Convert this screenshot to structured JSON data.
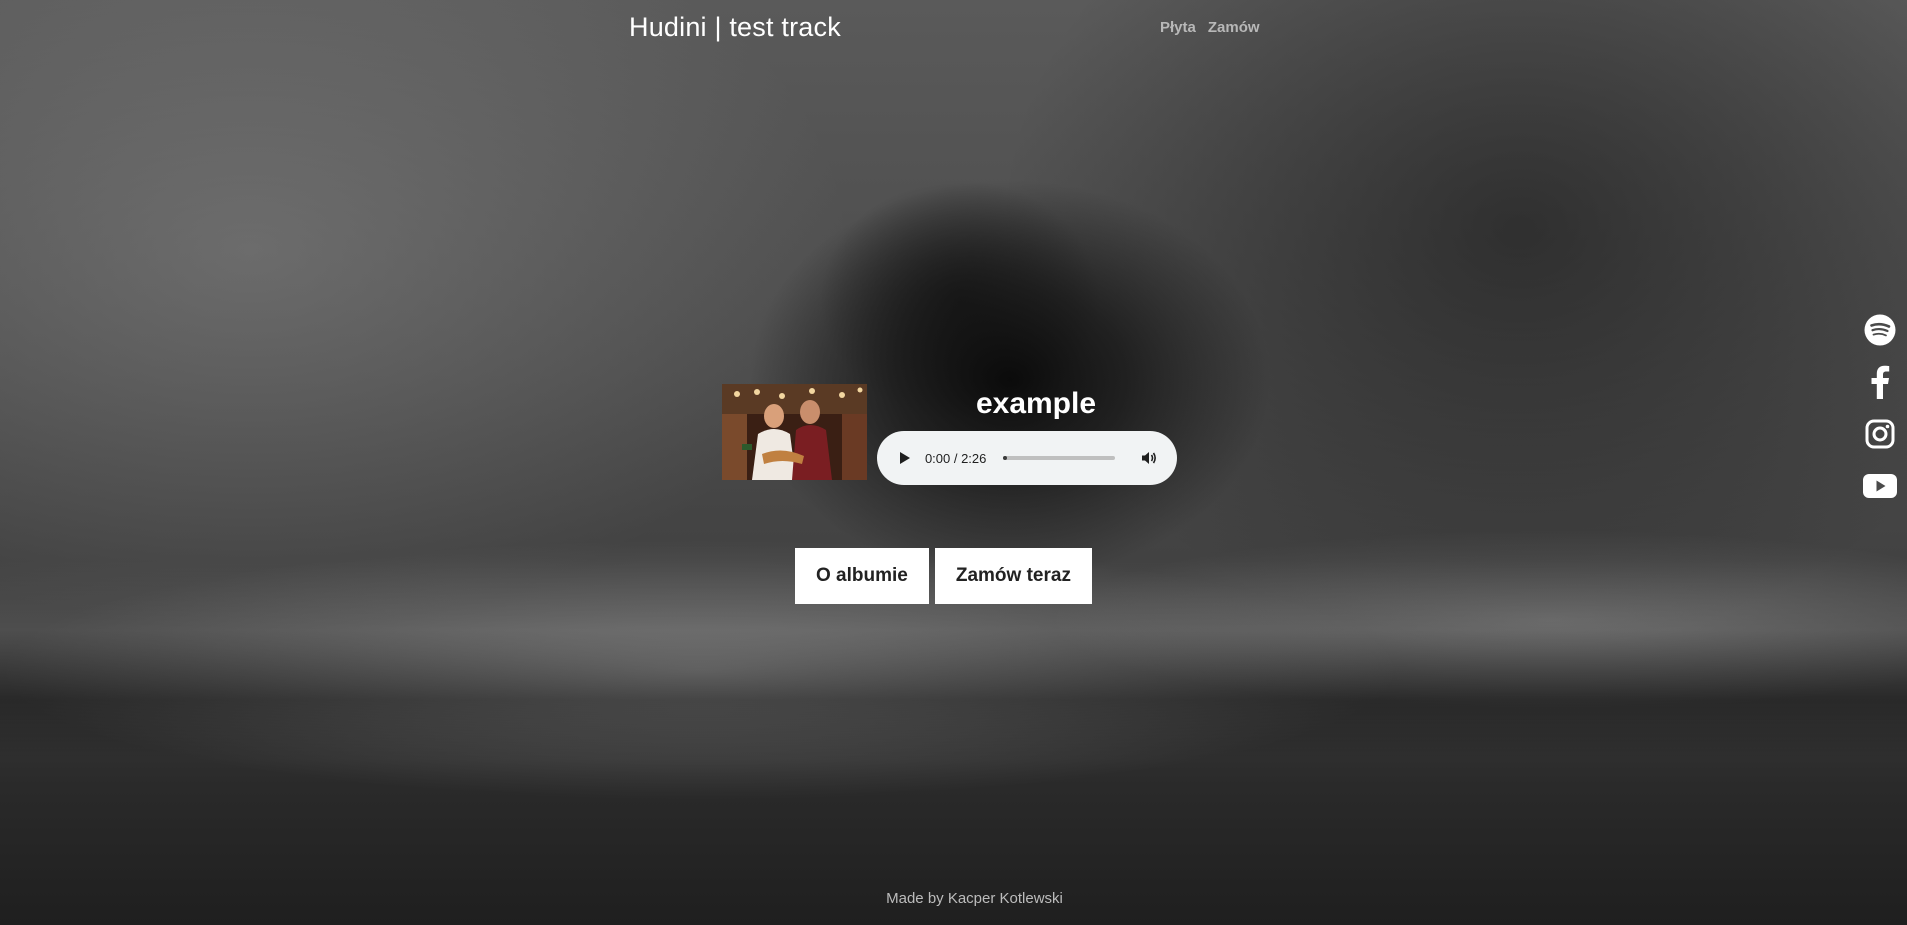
{
  "header": {
    "site_title": "Hudini | test track",
    "nav": [
      {
        "label": "Płyta"
      },
      {
        "label": "Zamów"
      }
    ]
  },
  "player": {
    "track_title": "example",
    "thumbnail_alt": "album photo",
    "time": "0:00 / 2:26",
    "progress_fraction": 0.03,
    "play_icon": "play-icon",
    "volume_icon": "volume-icon"
  },
  "cta": {
    "about_label": "O albumie",
    "order_label": "Zamów teraz"
  },
  "social": {
    "icons": [
      "spotify-icon",
      "facebook-icon",
      "instagram-icon",
      "youtube-icon"
    ]
  },
  "footer": {
    "credit": "Made by Kacper Kotlewski"
  },
  "colors": {
    "text": "#ffffff",
    "nav_text": "#b8b8b8",
    "player_bg": "#f1f3f4",
    "button_bg": "#ffffff",
    "button_text": "#222222",
    "footer_text": "#bcbcbc"
  }
}
